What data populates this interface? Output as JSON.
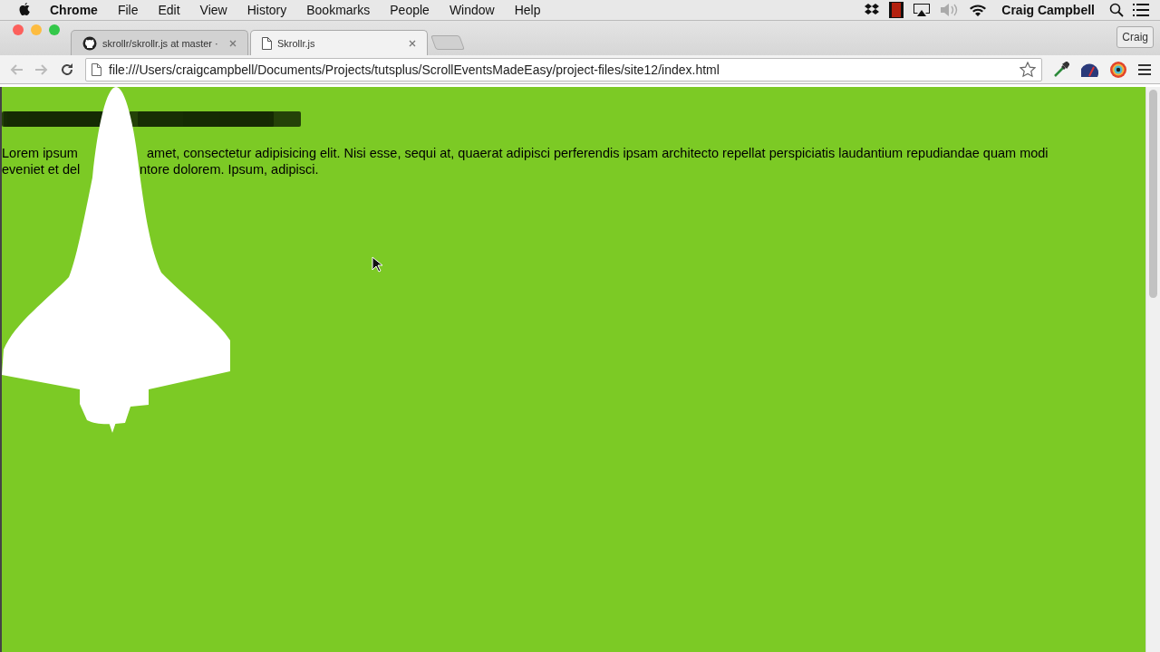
{
  "menu_bar": {
    "app": "Chrome",
    "items": [
      "File",
      "Edit",
      "View",
      "History",
      "Bookmarks",
      "People",
      "Window",
      "Help"
    ],
    "user": "Craig Campbell"
  },
  "tabs": [
    {
      "title": "skrollr/skrollr.js at master ·",
      "kind": "github",
      "selected": false
    },
    {
      "title": "Skrollr.js",
      "kind": "page",
      "selected": true
    }
  ],
  "profile_button": "Craig",
  "address": {
    "url": "file:///Users/craigcampbell/Documents/Projects/tutsplus/ScrollEventsMadeEasy/project-files/site12/index.html"
  },
  "page": {
    "paragraph_lines": [
      [
        "Lorem ipsum",
        "amet, consectetur adipisicing elit. Nisi esse, sequi at, quaerat adipisci perferendis ipsam architecto repellat perspiciatis laudantium repudiandae quam modi"
      ],
      [
        "eveniet et del",
        "ntore dolorem. Ipsum, adipisci."
      ]
    ]
  }
}
